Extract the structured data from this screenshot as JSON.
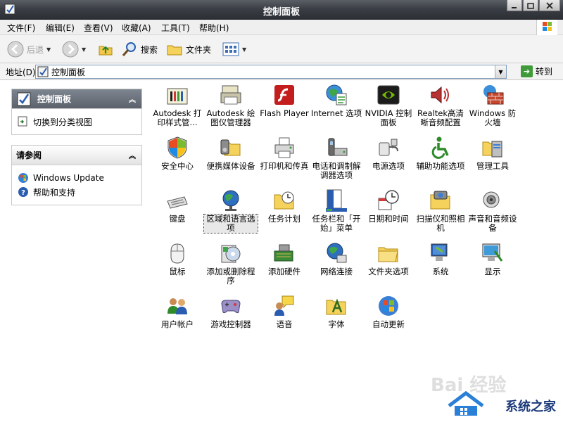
{
  "window": {
    "title": "控制面板"
  },
  "menu": [
    "文件(F)",
    "编辑(E)",
    "查看(V)",
    "收藏(A)",
    "工具(T)",
    "帮助(H)"
  ],
  "toolbar": {
    "back": "后退",
    "search": "搜索",
    "folders": "文件夹"
  },
  "address": {
    "label": "地址(D)",
    "value": "控制面板",
    "go": "转到"
  },
  "left": {
    "control_panel": {
      "title": "控制面板",
      "link": "切换到分类视图"
    },
    "see_also": {
      "title": "请参阅",
      "links": [
        "Windows Update",
        "帮助和支持"
      ]
    }
  },
  "items": [
    {
      "name": "Autodesk 打印样式管...",
      "icon": "autodesk-print-style-icon"
    },
    {
      "name": "Autodesk 绘图仪管理器",
      "icon": "autodesk-plotter-icon"
    },
    {
      "name": "Flash Player",
      "icon": "flash-icon"
    },
    {
      "name": "Internet 选项",
      "icon": "internet-options-icon"
    },
    {
      "name": "NVIDIA 控制面板",
      "icon": "nvidia-icon"
    },
    {
      "name": "Realtek高清晰音频配置",
      "icon": "realtek-audio-icon"
    },
    {
      "name": "Windows 防火墙",
      "icon": "firewall-icon"
    },
    {
      "name": "安全中心",
      "icon": "security-shield-icon"
    },
    {
      "name": "便携媒体设备",
      "icon": "portable-media-icon"
    },
    {
      "name": "打印机和传真",
      "icon": "printer-icon"
    },
    {
      "name": "电话和调制解调器选项",
      "icon": "phone-modem-icon"
    },
    {
      "name": "电源选项",
      "icon": "power-icon"
    },
    {
      "name": "辅助功能选项",
      "icon": "accessibility-icon"
    },
    {
      "name": "管理工具",
      "icon": "admin-tools-icon"
    },
    {
      "name": "键盘",
      "icon": "keyboard-icon"
    },
    {
      "name": "区域和语言选项",
      "icon": "globe-icon"
    },
    {
      "name": "任务计划",
      "icon": "scheduled-tasks-icon"
    },
    {
      "name": "任务栏和「开始」菜单",
      "icon": "taskbar-icon"
    },
    {
      "name": "日期和时间",
      "icon": "clock-icon"
    },
    {
      "name": "扫描仪和照相机",
      "icon": "scanner-icon"
    },
    {
      "name": "声音和音频设备",
      "icon": "speaker-icon"
    },
    {
      "name": "鼠标",
      "icon": "mouse-icon"
    },
    {
      "name": "添加或删除程序",
      "icon": "add-remove-icon"
    },
    {
      "name": "添加硬件",
      "icon": "add-hardware-icon"
    },
    {
      "name": "网络连接",
      "icon": "network-icon"
    },
    {
      "name": "文件夹选项",
      "icon": "folder-options-icon"
    },
    {
      "name": "系统",
      "icon": "system-icon"
    },
    {
      "name": "显示",
      "icon": "display-icon"
    },
    {
      "name": "用户帐户",
      "icon": "users-icon"
    },
    {
      "name": "游戏控制器",
      "icon": "gamepad-icon"
    },
    {
      "name": "语音",
      "icon": "speech-icon"
    },
    {
      "name": "字体",
      "icon": "fonts-icon"
    },
    {
      "name": "自动更新",
      "icon": "windows-flag-icon"
    }
  ],
  "watermark": "系统之家",
  "watermark_faint": "Bai 经验"
}
